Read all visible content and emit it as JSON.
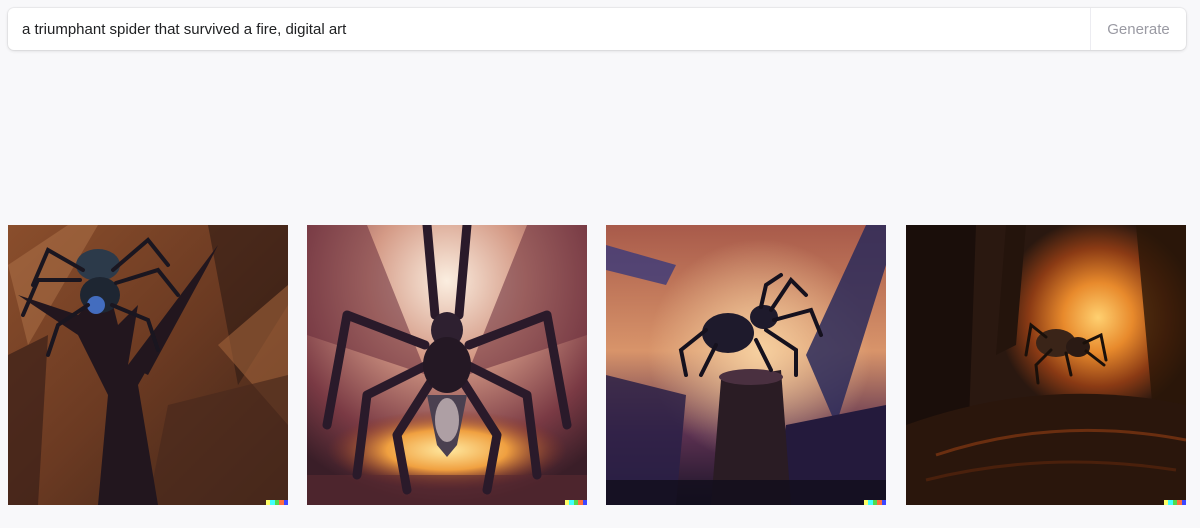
{
  "prompt": {
    "value": "a triumphant spider that survived a fire, digital art",
    "generate_label": "Generate"
  },
  "images": [
    {
      "name": "generated-image-1",
      "subject": "spider-on-dead-tree",
      "palette": [
        "#6b3a22",
        "#a0633a",
        "#2b1a22",
        "#3a6aa8"
      ]
    },
    {
      "name": "generated-image-2",
      "subject": "giant-spider-over-fire",
      "palette": [
        "#f2d8c0",
        "#7a3a44",
        "#2a1a2a",
        "#f0a040"
      ]
    },
    {
      "name": "generated-image-3",
      "subject": "spider-on-stump",
      "palette": [
        "#c87a5a",
        "#3a2a5a",
        "#1a1428",
        "#e8b060"
      ]
    },
    {
      "name": "generated-image-4",
      "subject": "spider-in-burning-forest",
      "palette": [
        "#2a1810",
        "#c8641e",
        "#ffb040",
        "#140a08"
      ]
    }
  ],
  "watermark_colors": [
    "#ffff66",
    "#42ffff",
    "#51da4c",
    "#ff6e3c",
    "#3c46ff"
  ]
}
